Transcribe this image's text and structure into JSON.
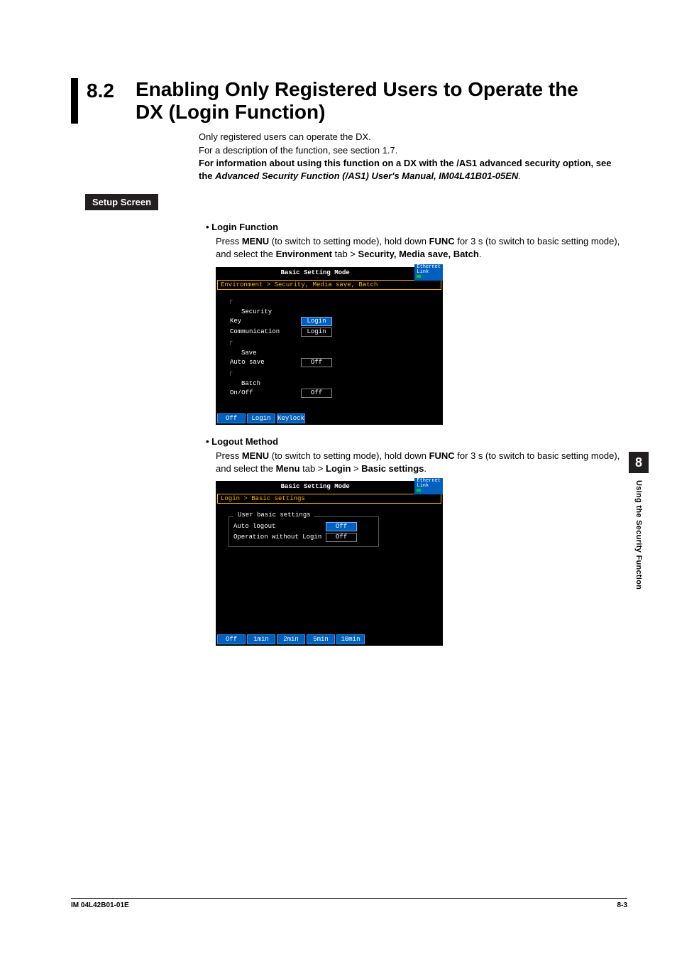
{
  "header": {
    "number": "8.2",
    "title_line1": "Enabling Only Registered Users to Operate the",
    "title_line2": "DX (Login Function)"
  },
  "intro": {
    "line1": "Only registered users can operate the DX.",
    "line2": "For a description of the function, see section 1.7.",
    "bold_part": "For information about using this function on a DX with the /AS1 advanced security option, see the ",
    "italic_part": "Advanced Security Function (/AS1) User's Manual, IM04L41B01-05EN",
    "end": "."
  },
  "setup_label": "Setup Screen",
  "login_section": {
    "title": "Login Function",
    "body_pre": "Press ",
    "body_menu": "MENU",
    "body_mid": " (to switch to setting mode), hold down ",
    "body_func": "FUNC",
    "body_tail1": " for 3 s (to switch to basic setting mode), and select the ",
    "body_env": "Environment",
    "body_tail2": " tab > ",
    "body_sec": "Security, Media save, Batch",
    "body_end": "."
  },
  "screen1": {
    "title": "Basic Setting Mode",
    "eth1": "Ethernet",
    "eth2": "Link",
    "breadcrumb": "Environment > Security, Media save, Batch",
    "group_security": "Security",
    "row_key_label": "Key",
    "row_key_value": "Login",
    "row_comm_label": "Communication",
    "row_comm_value": "Login",
    "group_save": "Save",
    "row_autosave_label": "Auto save",
    "row_autosave_value": "Off",
    "group_batch": "Batch",
    "row_onoff_label": "On/Off",
    "row_onoff_value": "Off",
    "softkeys": [
      "Off",
      "Login",
      "Keylock"
    ]
  },
  "logout_section": {
    "title": "Logout Method",
    "body_pre": "Press ",
    "body_menu": "MENU",
    "body_mid": " (to switch to setting mode), hold down ",
    "body_func": "FUNC",
    "body_tail1": " for 3 s (to switch to basic setting mode), and select the ",
    "body_menu2": "Menu",
    "body_tail2": " tab > ",
    "body_login": "Login",
    "body_tail3": " > ",
    "body_basic": "Basic settings",
    "body_end": "."
  },
  "screen2": {
    "title": "Basic Setting Mode",
    "eth1": "Ethernet",
    "eth2": "Link",
    "breadcrumb": "Login > Basic settings",
    "group_label": "User basic settings",
    "row_autologout_label": "Auto logout",
    "row_autologout_value": "Off",
    "row_opwo_label": "Operation without Login",
    "row_opwo_value": "Off",
    "softkeys": [
      "Off",
      "1min",
      "2min",
      "5min",
      "10min"
    ]
  },
  "side": {
    "num": "8",
    "text": "Using the Security Function"
  },
  "footer": {
    "left": "IM 04L42B01-01E",
    "right": "8-3"
  }
}
